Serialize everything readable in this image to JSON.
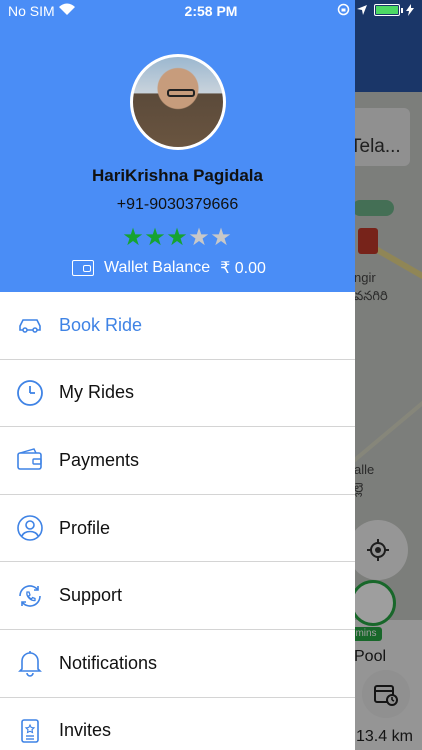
{
  "status_bar": {
    "carrier": "No SIM",
    "time": "2:58 PM"
  },
  "background": {
    "search_text": "Tela...",
    "place_1": "ngir",
    "place_2": "వనగిరి",
    "place_3": "alle",
    "place_4": "ల్లె",
    "eta_badge": "mins",
    "ride_type": "Pool",
    "distance": "13.4 km"
  },
  "drawer": {
    "user": {
      "name": "HariKrishna Pagidala",
      "phone": "+91-9030379666",
      "rating": 3,
      "rating_max": 5
    },
    "wallet": {
      "label": "Wallet Balance",
      "amount": "₹ 0.00"
    },
    "menu": [
      {
        "label": "Book Ride",
        "icon": "car-icon",
        "active": true
      },
      {
        "label": "My Rides",
        "icon": "clock-icon",
        "active": false
      },
      {
        "label": "Payments",
        "icon": "wallet-icon",
        "active": false
      },
      {
        "label": "Profile",
        "icon": "profile-icon",
        "active": false
      },
      {
        "label": "Support",
        "icon": "support-icon",
        "active": false
      },
      {
        "label": "Notifications",
        "icon": "bell-icon",
        "active": false
      },
      {
        "label": "Invites",
        "icon": "invite-icon",
        "active": false
      }
    ]
  },
  "colors": {
    "header_blue": "#4a8df6",
    "active_blue": "#3f83e5",
    "star_green": "#16a332",
    "star_grey": "#c8c8c8"
  }
}
